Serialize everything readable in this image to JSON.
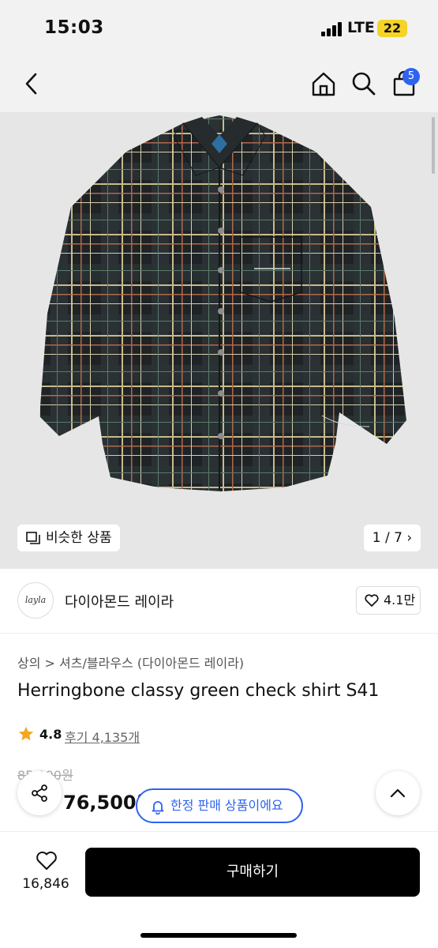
{
  "status_bar": {
    "time": "15:03",
    "network": "LTE",
    "battery": "22"
  },
  "nav": {
    "cart_badge": "5",
    "icons": [
      "back-arrow-icon",
      "home-icon",
      "search-icon",
      "shopping-bag-icon"
    ]
  },
  "gallery": {
    "similar_label": "비슷한 상품",
    "counter": "1 / 7"
  },
  "brand": {
    "logo_text": "layla",
    "name": "다이아몬드 레이라",
    "likes": "4.1만"
  },
  "product": {
    "breadcrumb_primary": "상의",
    "breadcrumb_secondary": "셔츠/블라우스 (다이아몬드 레이라)",
    "title": "Herringbone classy green check shirt S41",
    "rating": "4.8",
    "reviews": "후기 4,135개",
    "original_price": "85,000원",
    "price": "76,500원"
  },
  "limited_pill": "한정 판매 상품이에요",
  "bottom": {
    "wish_count": "16,846",
    "buy_label": "구매하기"
  },
  "colors": {
    "accent_blue": "#2e63f0",
    "star": "#f5a623",
    "battery": "#f5d327"
  }
}
